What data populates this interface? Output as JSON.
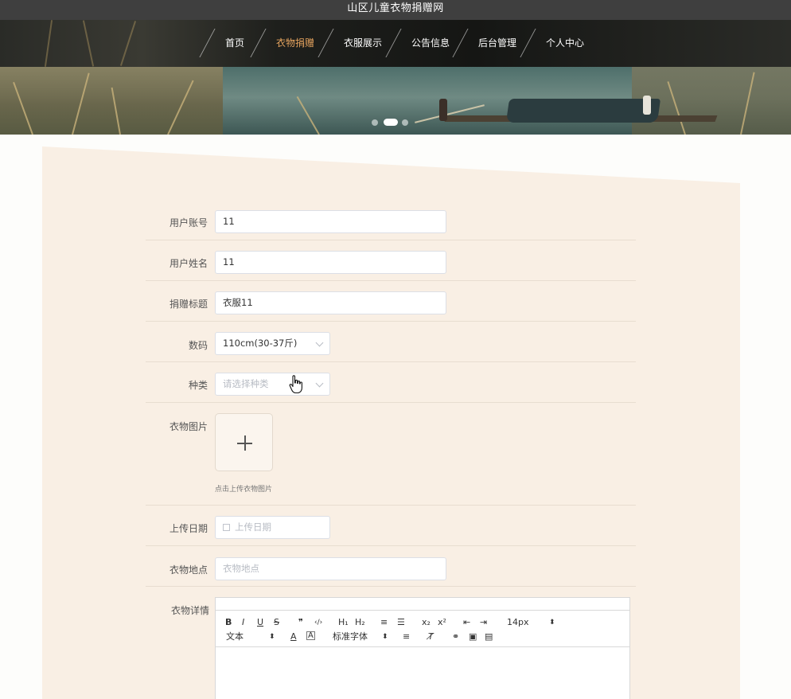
{
  "site": {
    "title": "山区儿童衣物捐赠网"
  },
  "nav": {
    "items": [
      {
        "label": "首页"
      },
      {
        "label": "衣物捐赠"
      },
      {
        "label": "衣服展示"
      },
      {
        "label": "公告信息"
      },
      {
        "label": "后台管理"
      },
      {
        "label": "个人中心"
      }
    ],
    "active_index": 1
  },
  "carousel": {
    "slide_count": 3,
    "active_slide": 2
  },
  "form": {
    "account": {
      "label": "用户账号",
      "value": "11"
    },
    "name": {
      "label": "用户姓名",
      "value": "11"
    },
    "title": {
      "label": "捐赠标题",
      "value": "衣服11"
    },
    "size": {
      "label": "数码",
      "value": "110cm(30-37斤)"
    },
    "category": {
      "label": "种类",
      "placeholder": "请选择种类"
    },
    "image": {
      "label": "衣物图片",
      "hint": "点击上传衣物图片"
    },
    "date": {
      "label": "上传日期",
      "placeholder": "上传日期"
    },
    "location": {
      "label": "衣物地点",
      "placeholder": "衣物地点"
    },
    "detail": {
      "label": "衣物详情"
    }
  },
  "editor": {
    "buttons": {
      "bold": "B",
      "italic": "I",
      "underline": "U",
      "strike": "S",
      "quote": "❞",
      "code": "‹/›",
      "h1": "H₁",
      "h2": "H₂",
      "ordered_list": "≡",
      "bullet_list": "☰",
      "subscript": "x₂",
      "superscript": "x²",
      "outdent": "⇤",
      "indent": "⇥",
      "size": "14px",
      "block": "文本",
      "color": "A",
      "background": "A̲",
      "font": "标准字体",
      "align": "≡",
      "clean": "T̸",
      "link": "⚭",
      "image": "▣",
      "video": "▤"
    },
    "select_arrow": "⬍"
  }
}
